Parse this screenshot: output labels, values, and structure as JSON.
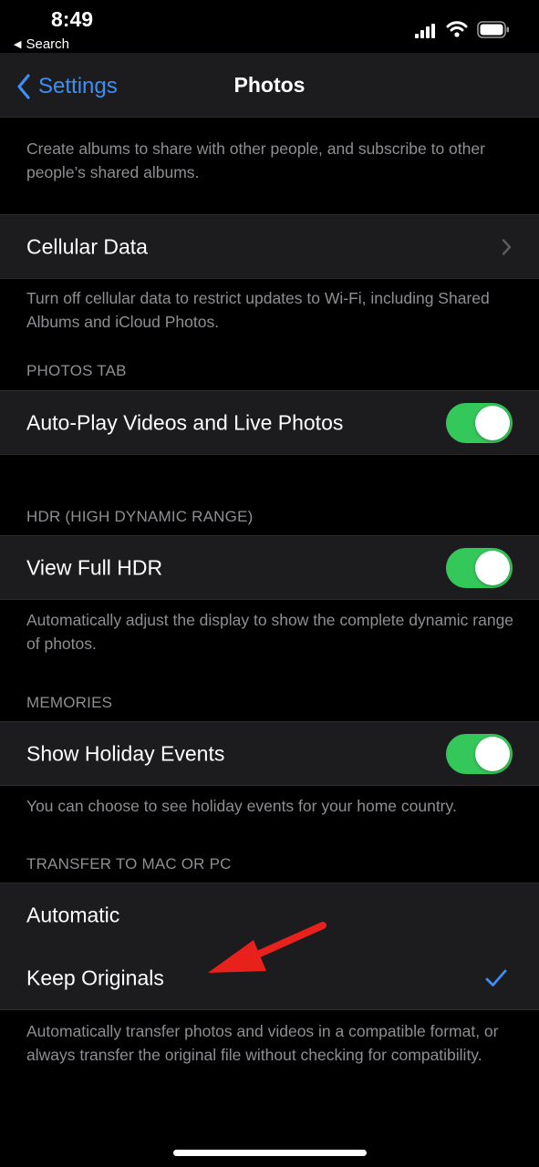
{
  "status": {
    "time": "8:49",
    "back_app": "Search"
  },
  "nav": {
    "back_label": "Settings",
    "title": "Photos"
  },
  "shared_albums_footer": "Create albums to share with other people, and subscribe to other people’s shared albums.",
  "cellular": {
    "label": "Cellular Data",
    "footer": "Turn off cellular data to restrict updates to Wi-Fi, including Shared Albums and iCloud Photos."
  },
  "photos_tab": {
    "header": "PHOTOS TAB",
    "autoplay_label": "Auto-Play Videos and Live Photos",
    "autoplay_on": true
  },
  "hdr": {
    "header": "HDR (HIGH DYNAMIC RANGE)",
    "label": "View Full HDR",
    "on": true,
    "footer": "Automatically adjust the display to show the complete dynamic range of photos."
  },
  "memories": {
    "header": "MEMORIES",
    "label": "Show Holiday Events",
    "on": true,
    "footer": "You can choose to see holiday events for your home country."
  },
  "transfer": {
    "header": "TRANSFER TO MAC OR PC",
    "options": [
      "Automatic",
      "Keep Originals"
    ],
    "selected": "Keep Originals",
    "footer": "Automatically transfer photos and videos in a compatible format, or always transfer the original file without checking for compatibility."
  },
  "colors": {
    "accent": "#3d8ff5",
    "toggle_on": "#34c759",
    "annotation_arrow": "#e8211c"
  }
}
